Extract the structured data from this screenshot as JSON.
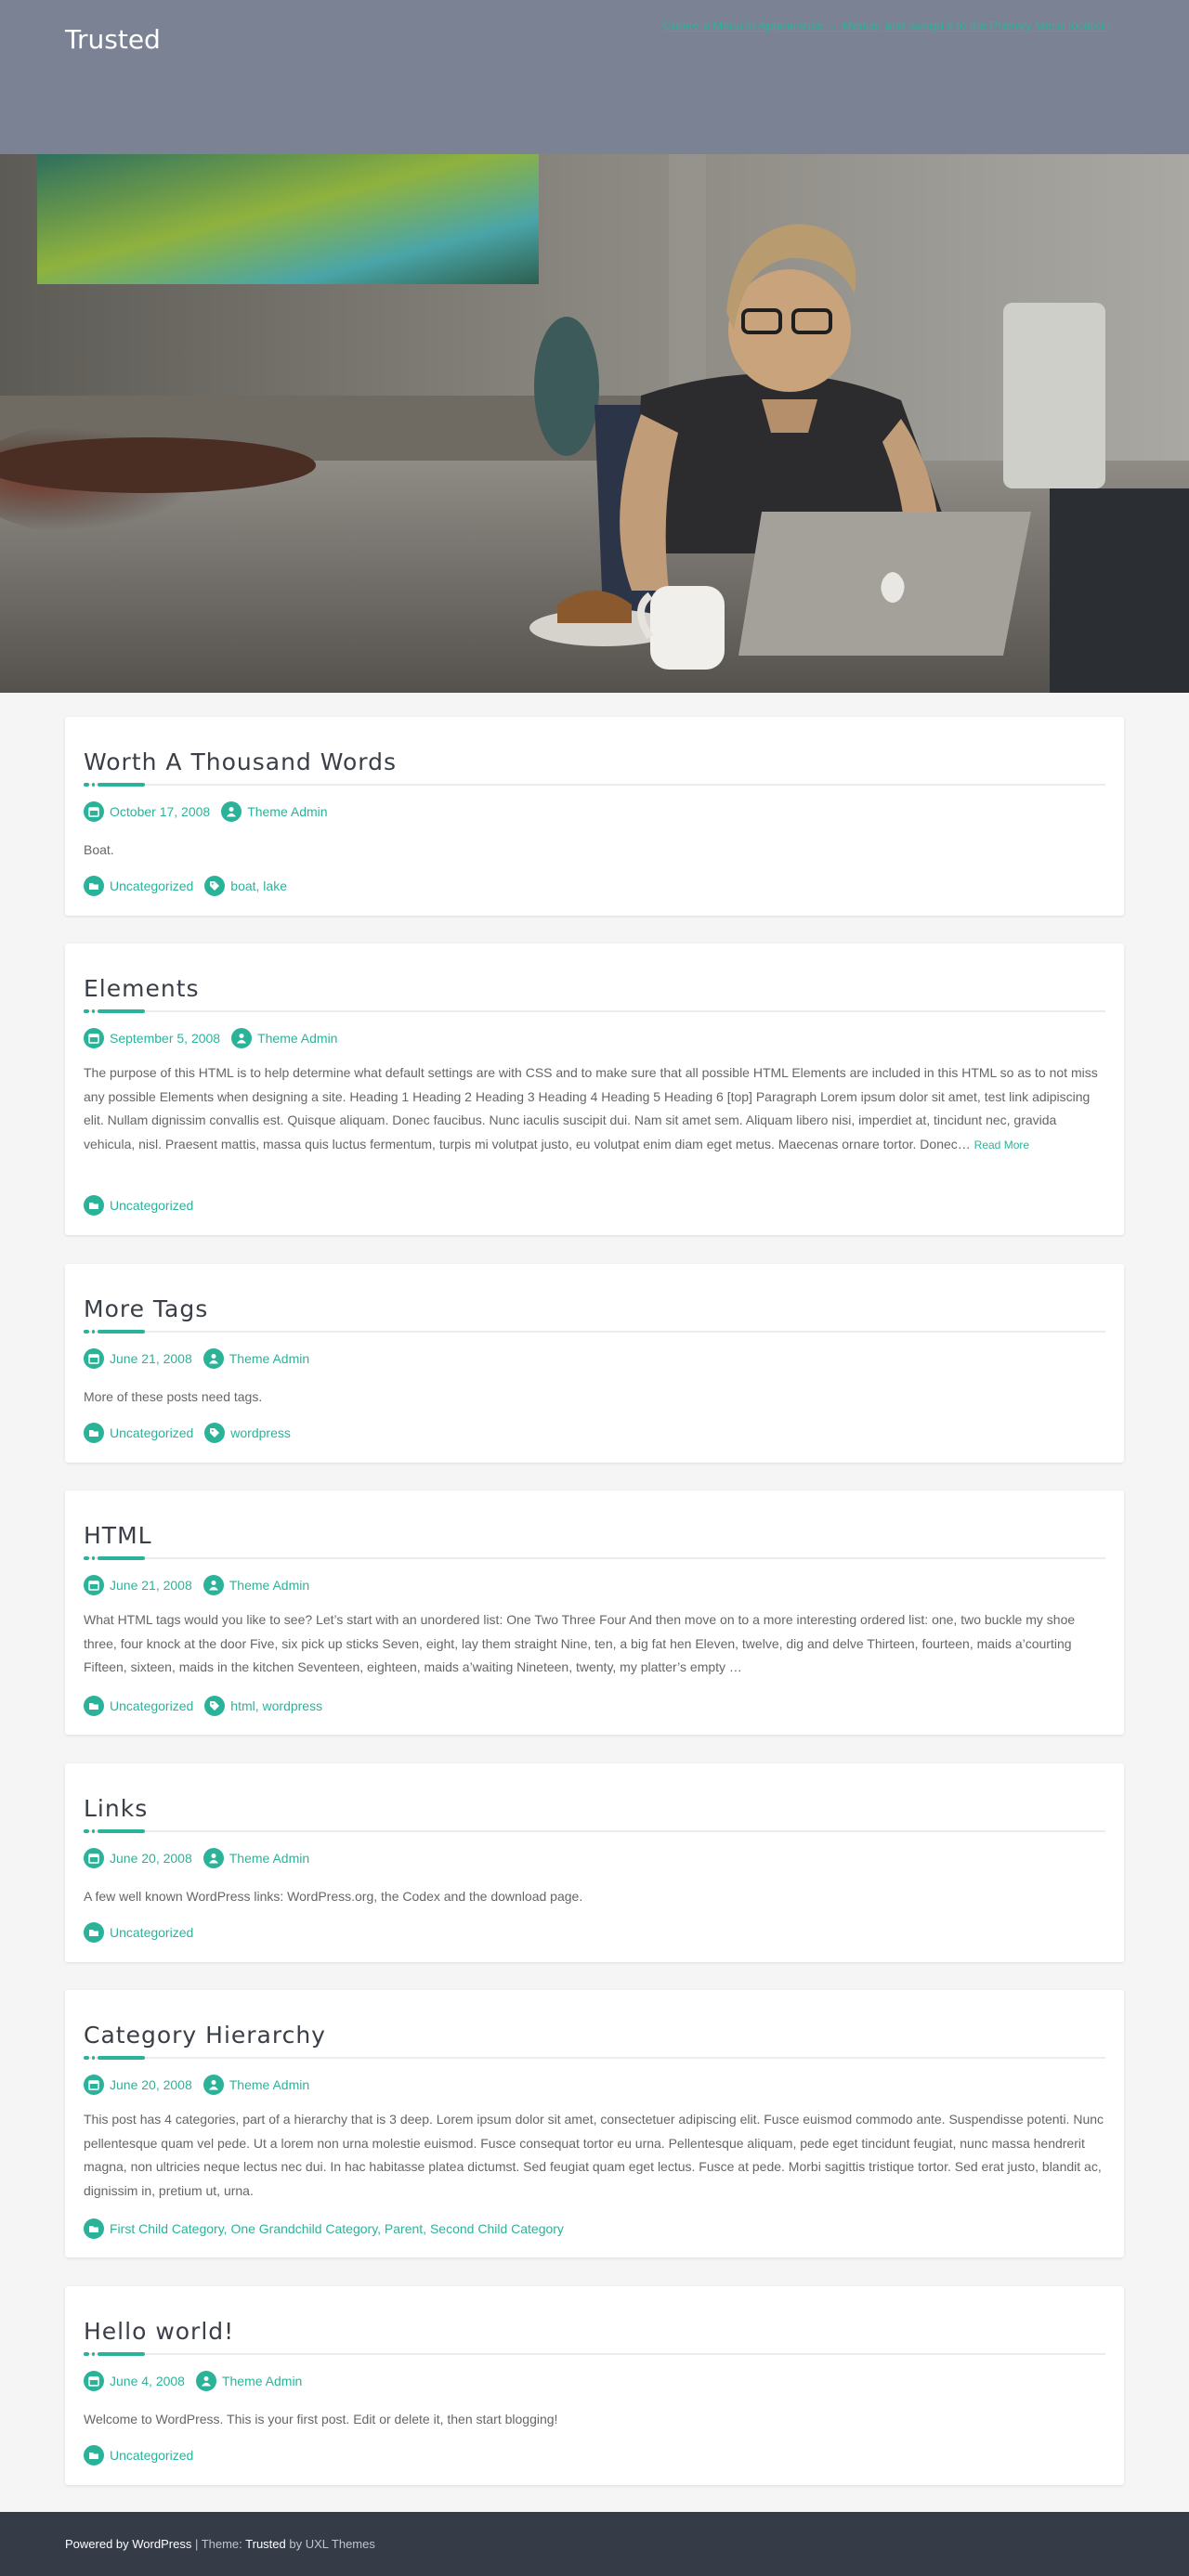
{
  "site": {
    "title": "Trusted",
    "top_link": "Create a Menu in Appearance → Menus, and assign it to the Primary Menu location",
    "accent_color": "#2bb39a",
    "header_color": "#7a8293"
  },
  "icons": {
    "date": "calendar-icon",
    "author": "user-icon",
    "category": "folder-icon",
    "tags": "tag-icon"
  },
  "posts": [
    {
      "title": "Worth A Thousand Words",
      "date": "October 17, 2008",
      "author": "Theme Admin",
      "excerpt": "Boat.",
      "more": "",
      "categories": "Uncategorized",
      "tags": "boat, lake"
    },
    {
      "title": "Elements",
      "date": "September 5, 2008",
      "author": "Theme Admin",
      "excerpt": "The purpose of this HTML is to help determine what default settings are with CSS and to make sure that all possible HTML Elements are included in this HTML so as to not miss any possible Elements when designing a site. Heading 1 Heading 2 Heading 3 Heading 4 Heading 5 Heading 6 [top] Paragraph Lorem ipsum dolor sit amet, test link adipiscing elit. Nullam dignissim convallis est. Quisque aliquam. Donec faucibus. Nunc iaculis suscipit dui. Nam sit amet sem. Aliquam libero nisi, imperdiet at, tincidunt nec, gravida vehicula, nisl. Praesent mattis, massa quis luctus fermentum, turpis mi volutpat justo, eu volutpat enim diam eget metus. Maecenas ornare tortor. Donec…",
      "more": "Read More",
      "categories": "Uncategorized",
      "tags": ""
    },
    {
      "title": "More Tags",
      "date": "June 21, 2008",
      "author": "Theme Admin",
      "excerpt": "More of these posts need tags.",
      "more": "",
      "categories": "Uncategorized",
      "tags": "wordpress"
    },
    {
      "title": "HTML",
      "date": "June 21, 2008",
      "author": "Theme Admin",
      "excerpt": "What HTML tags would you like to see? Let’s start with an unordered list: One Two Three Four And then move on to a more interesting ordered list: one, two buckle my shoe three, four knock at the door Five, six pick up sticks Seven, eight, lay them straight Nine, ten, a big fat hen Eleven, twelve, dig and delve Thirteen, fourteen, maids a’courting Fifteen, sixteen, maids in the kitchen Seventeen, eighteen, maids a’waiting Nineteen, twenty, my platter’s empty …",
      "more": "",
      "categories": "Uncategorized",
      "tags": "html, wordpress"
    },
    {
      "title": "Links",
      "date": "June 20, 2008",
      "author": "Theme Admin",
      "excerpt": "A few well known WordPress links: WordPress.org, the Codex and the download page.",
      "more": "",
      "categories": "Uncategorized",
      "tags": ""
    },
    {
      "title": "Category Hierarchy",
      "date": "June 20, 2008",
      "author": "Theme Admin",
      "excerpt": "This post has 4 categories, part of a hierarchy that is 3 deep. Lorem ipsum dolor sit amet, consectetuer adipiscing elit. Fusce euismod commodo ante. Suspendisse potenti. Nunc pellentesque quam vel pede. Ut a lorem non urna molestie euismod. Fusce consequat tortor eu urna. Pellentesque aliquam, pede eget tincidunt feugiat, nunc massa hendrerit magna, non ultricies neque lectus nec dui. In hac habitasse platea dictumst. Sed feugiat quam eget lectus. Fusce at pede. Morbi sagittis tristique tortor. Sed erat justo, blandit ac, dignissim in, pretium ut, urna.",
      "more": "",
      "categories": "First Child Category, One Grandchild Category, Parent, Second Child Category",
      "tags": ""
    },
    {
      "title": "Hello world!",
      "date": "June 4, 2008",
      "author": "Theme Admin",
      "excerpt": "Welcome to WordPress. This is your first post. Edit or delete it, then start blogging!",
      "more": "",
      "categories": "Uncategorized",
      "tags": ""
    }
  ],
  "footer": {
    "powered": "Powered by WordPress",
    "sep": " | Theme: ",
    "theme": "Trusted",
    "by": " by ",
    "author": "UXL Themes"
  }
}
